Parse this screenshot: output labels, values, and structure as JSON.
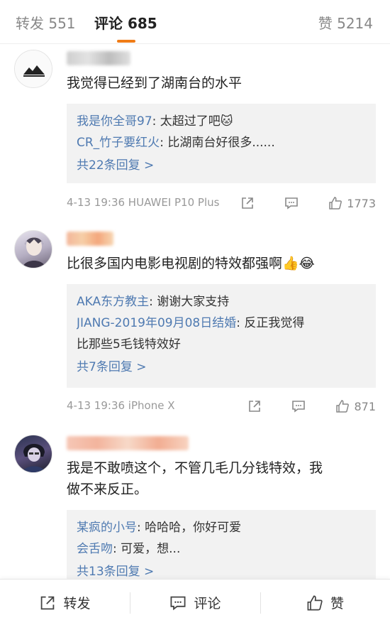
{
  "tabs": {
    "repost": "转发 551",
    "comment": "评论 685",
    "like": "赞 5214"
  },
  "comments": [
    {
      "text": "我觉得已经到了湖南台的水平",
      "replies": [
        {
          "name": "我是你全哥97",
          "text": ": 太超过了吧🐱"
        },
        {
          "name": "CR_竹子要红火",
          "text": ": 比湖南台好很多......"
        }
      ],
      "more": "共22条回复 >",
      "time": "4-13 19:36  HUAWEI P10 Plus",
      "likes": "1773"
    },
    {
      "text": "比很多国内电影电视剧的特效都强啊👍😂",
      "replies": [
        {
          "name": "AKA东方教主",
          "text": ": 谢谢大家支持"
        },
        {
          "name": "JIANG-2019年09月08日结婚",
          "text": ": 反正我觉得"
        }
      ],
      "reply_cont": "比那些5毛钱特效好",
      "more": "共7条回复 >",
      "time": "4-13 19:36  iPhone X",
      "likes": "871"
    },
    {
      "text_line1": "我是不敢喷这个，不管几毛几分钱特效，我",
      "text_line2": "做不来反正。",
      "replies": [
        {
          "name": "某疯的小号",
          "text": ": 哈哈哈，你好可爱"
        },
        {
          "name": "会舌吻",
          "text": ": 可爱，想..."
        }
      ],
      "more": "共13条回复 >"
    }
  ],
  "bottom_bar": {
    "repost": "转发",
    "comment": "评论",
    "like": "赞"
  }
}
